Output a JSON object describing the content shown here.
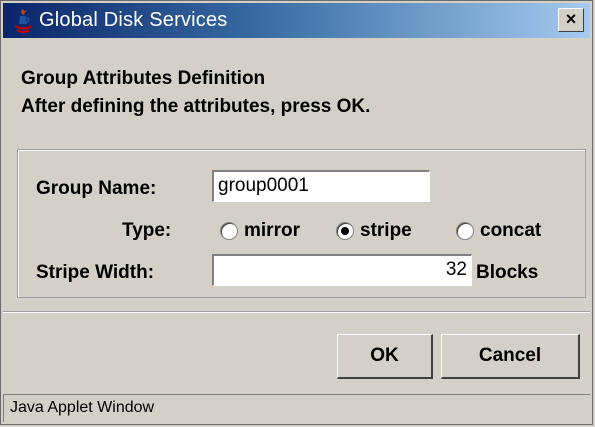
{
  "window": {
    "title": "Global Disk Services",
    "close_glyph": "×",
    "title_icon": "java-coffee-icon"
  },
  "instructions": {
    "line1": "Group Attributes Definition",
    "line2": "After defining the attributes, press OK."
  },
  "form": {
    "group_name_label": "Group Name:",
    "group_name_value": "group0001",
    "type_label": "Type:",
    "type_options": [
      {
        "label": "mirror",
        "selected": false
      },
      {
        "label": "stripe",
        "selected": true
      },
      {
        "label": "concat",
        "selected": false
      }
    ],
    "stripe_width_label": "Stripe Width:",
    "stripe_width_value": "32",
    "stripe_width_unit": "Blocks"
  },
  "buttons": {
    "ok_label": "OK",
    "cancel_label": "Cancel"
  },
  "status": {
    "text": "Java Applet Window"
  },
  "colors": {
    "title_start": "#0a246a",
    "title_end": "#a6caf0",
    "face": "#d4d0c8"
  }
}
